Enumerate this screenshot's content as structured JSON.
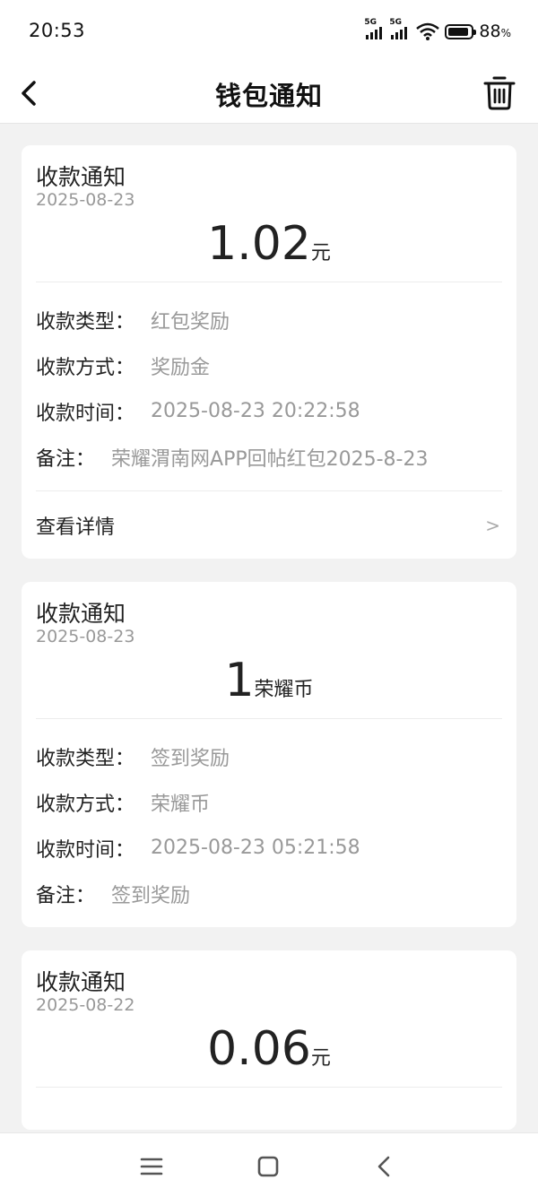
{
  "status": {
    "time": "20:53",
    "signal1": "5G",
    "signal2": "5G",
    "battery_percent": "88",
    "battery_unit": "%",
    "battery_level": 0.88
  },
  "header": {
    "title": "钱包通知"
  },
  "cards": [
    {
      "title": "收款通知",
      "date": "2025-08-23",
      "amount": "1.02",
      "unit": "元",
      "rows": [
        {
          "label": "收款类型：",
          "value": "红包奖励"
        },
        {
          "label": "收款方式：",
          "value": "奖励金"
        },
        {
          "label": "收款时间：",
          "value": "2025-08-23 20:22:58"
        },
        {
          "label": "备注：",
          "value": "荣耀渭南网APP回帖红包2025-8-23"
        }
      ],
      "detail_label": "查看详情",
      "detail_chevron": ">"
    },
    {
      "title": "收款通知",
      "date": "2025-08-23",
      "amount": "1",
      "unit": "荣耀币",
      "rows": [
        {
          "label": "收款类型：",
          "value": "签到奖励"
        },
        {
          "label": "收款方式：",
          "value": "荣耀币"
        },
        {
          "label": "收款时间：",
          "value": "2025-08-23 05:21:58"
        },
        {
          "label": "备注：",
          "value": "签到奖励"
        }
      ]
    },
    {
      "title": "收款通知",
      "date": "2025-08-22",
      "amount": "0.06",
      "unit": "元"
    }
  ],
  "icons": {
    "back": "back-chevron-icon",
    "delete": "trash-icon",
    "nav_menu": "menu-icon",
    "nav_home": "home-square-icon",
    "nav_back": "back-triangle-icon"
  }
}
